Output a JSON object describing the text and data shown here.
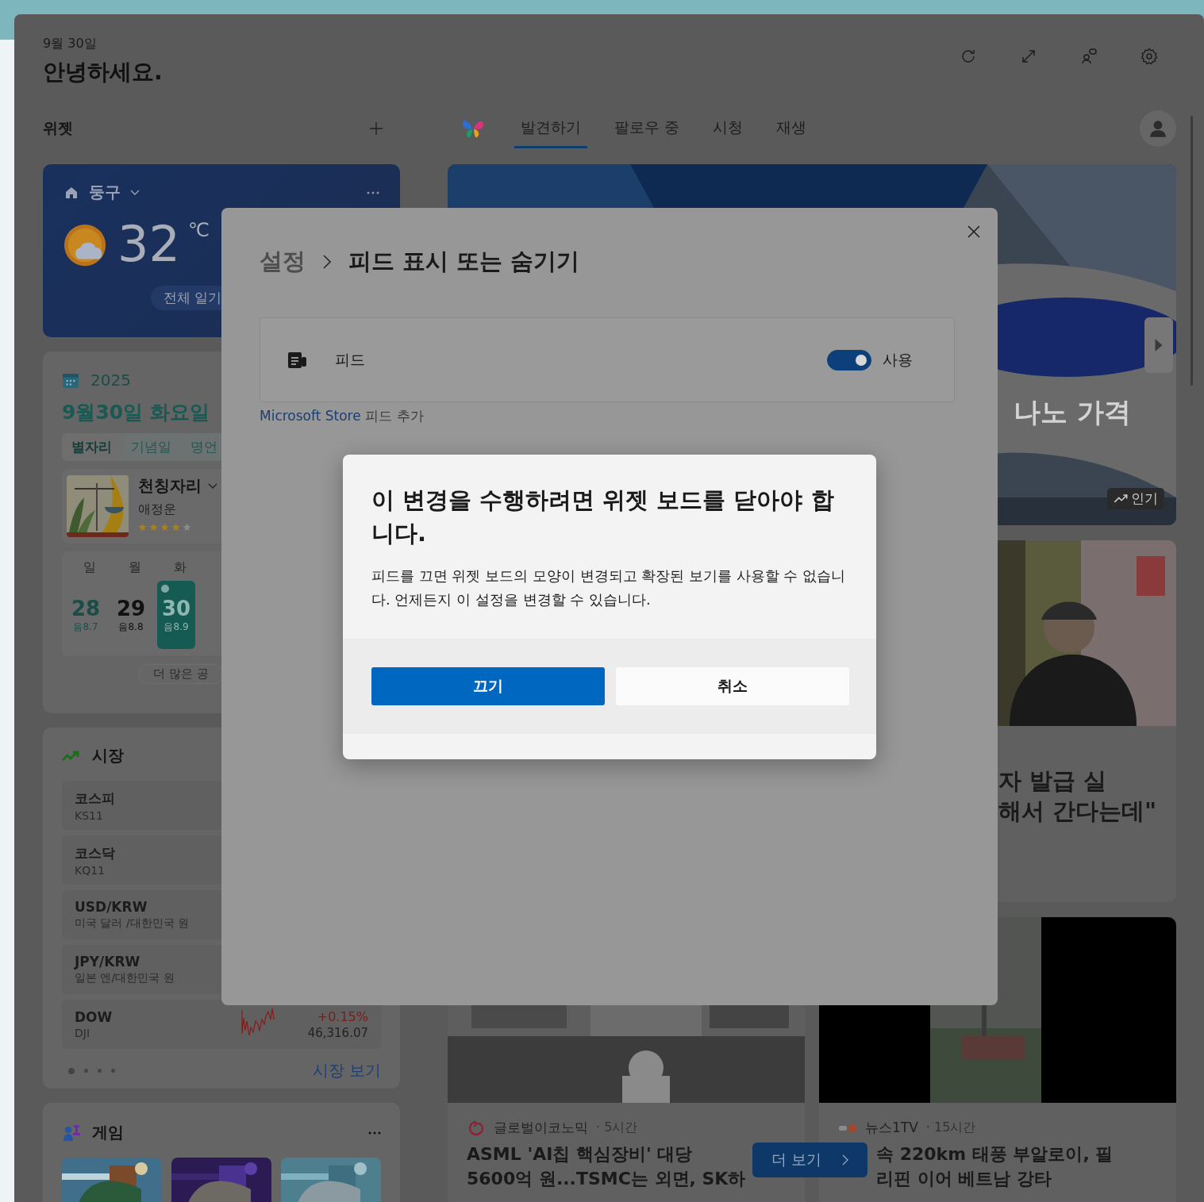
{
  "header": {
    "date": "9월 30일",
    "greeting": "안녕하세요."
  },
  "widgets": {
    "title": "위젯"
  },
  "nav": {
    "tabs": [
      {
        "label": "발견하기",
        "selected": true
      },
      {
        "label": "팔로우 중",
        "selected": false
      },
      {
        "label": "시청",
        "selected": false
      },
      {
        "label": "재생",
        "selected": false
      }
    ]
  },
  "weather": {
    "location": "둥구",
    "temperature": "32",
    "unit": "℃",
    "forecast_button": "전체 일기"
  },
  "calendar": {
    "year": "2025",
    "date": "9월30일 화요일",
    "tabs": [
      {
        "label": "별자리",
        "selected": true
      },
      {
        "label": "기념일",
        "selected": false
      },
      {
        "label": "명언",
        "selected": false
      }
    ],
    "horoscope": {
      "sign": "천칭자리",
      "category": "애정운",
      "stars": 4
    },
    "weekdays": [
      "일",
      "월",
      "화"
    ],
    "days": [
      {
        "day": "28",
        "lunar": "음8.7",
        "kind": "sunday",
        "selected": false,
        "event": false
      },
      {
        "day": "29",
        "lunar": "음8.8",
        "kind": "weekday",
        "selected": false,
        "event": false
      },
      {
        "day": "30",
        "lunar": "음8.9",
        "kind": "weekday",
        "selected": true,
        "event": true
      }
    ],
    "more_button": "더 많은 공"
  },
  "market": {
    "title": "시장",
    "rows": [
      {
        "name": "코스피",
        "symbol": "KS11"
      },
      {
        "name": "코스닥",
        "symbol": "KQ11"
      },
      {
        "name": "USD/KRW",
        "symbol": "미국 달러 /대한민국 원"
      },
      {
        "name": "JPY/KRW",
        "symbol": "일본 엔/대한민국 원"
      },
      {
        "name": "DOW",
        "symbol": "DJI",
        "change": "+0.15%",
        "price": "46,316.07"
      }
    ],
    "pages": [
      {
        "selected": true
      },
      {
        "selected": false
      },
      {
        "selected": false
      },
      {
        "selected": false
      }
    ],
    "link": "시장 보기"
  },
  "games": {
    "title": "게임"
  },
  "feed": {
    "hero": {
      "headline": "나노 가격",
      "badge": "인기"
    },
    "cards": [
      {
        "headline": "자 발급 실\n해서 간다는데\""
      },
      {
        "source": "글로벌이코노믹",
        "age": "· 5시간",
        "headline": "ASML 'AI칩 핵심장비' 대당\n5600억 원...TSMC는 외면, SK하"
      },
      {
        "source": "뉴스1TV",
        "age": "· 15시간",
        "headline": "속 220km 태풍 부알로이, 필\n리핀 이어 베트남 강타"
      }
    ],
    "more_button": "더 보기"
  },
  "settings": {
    "breadcrumb_root": "설정",
    "title": "피드 표시 또는 숨기기",
    "feed_row": {
      "label": "피드",
      "on": true,
      "state_label": "사용"
    },
    "store_link": "Microsoft Store",
    "store_suffix": "피드 추가"
  },
  "dialog": {
    "title": "이 변경을 수행하려면 위젯 보드를 닫아야 합니다.",
    "body": "피드를 끄면 위젯 보드의 모양이 변경되고 확장된 보기를 사용할 수 없습니다. 언제든지 이 설정을 변경할 수 있습니다.",
    "buttons": [
      {
        "label": "끄기",
        "kind": "primary"
      },
      {
        "label": "취소",
        "kind": "secondary"
      }
    ]
  }
}
